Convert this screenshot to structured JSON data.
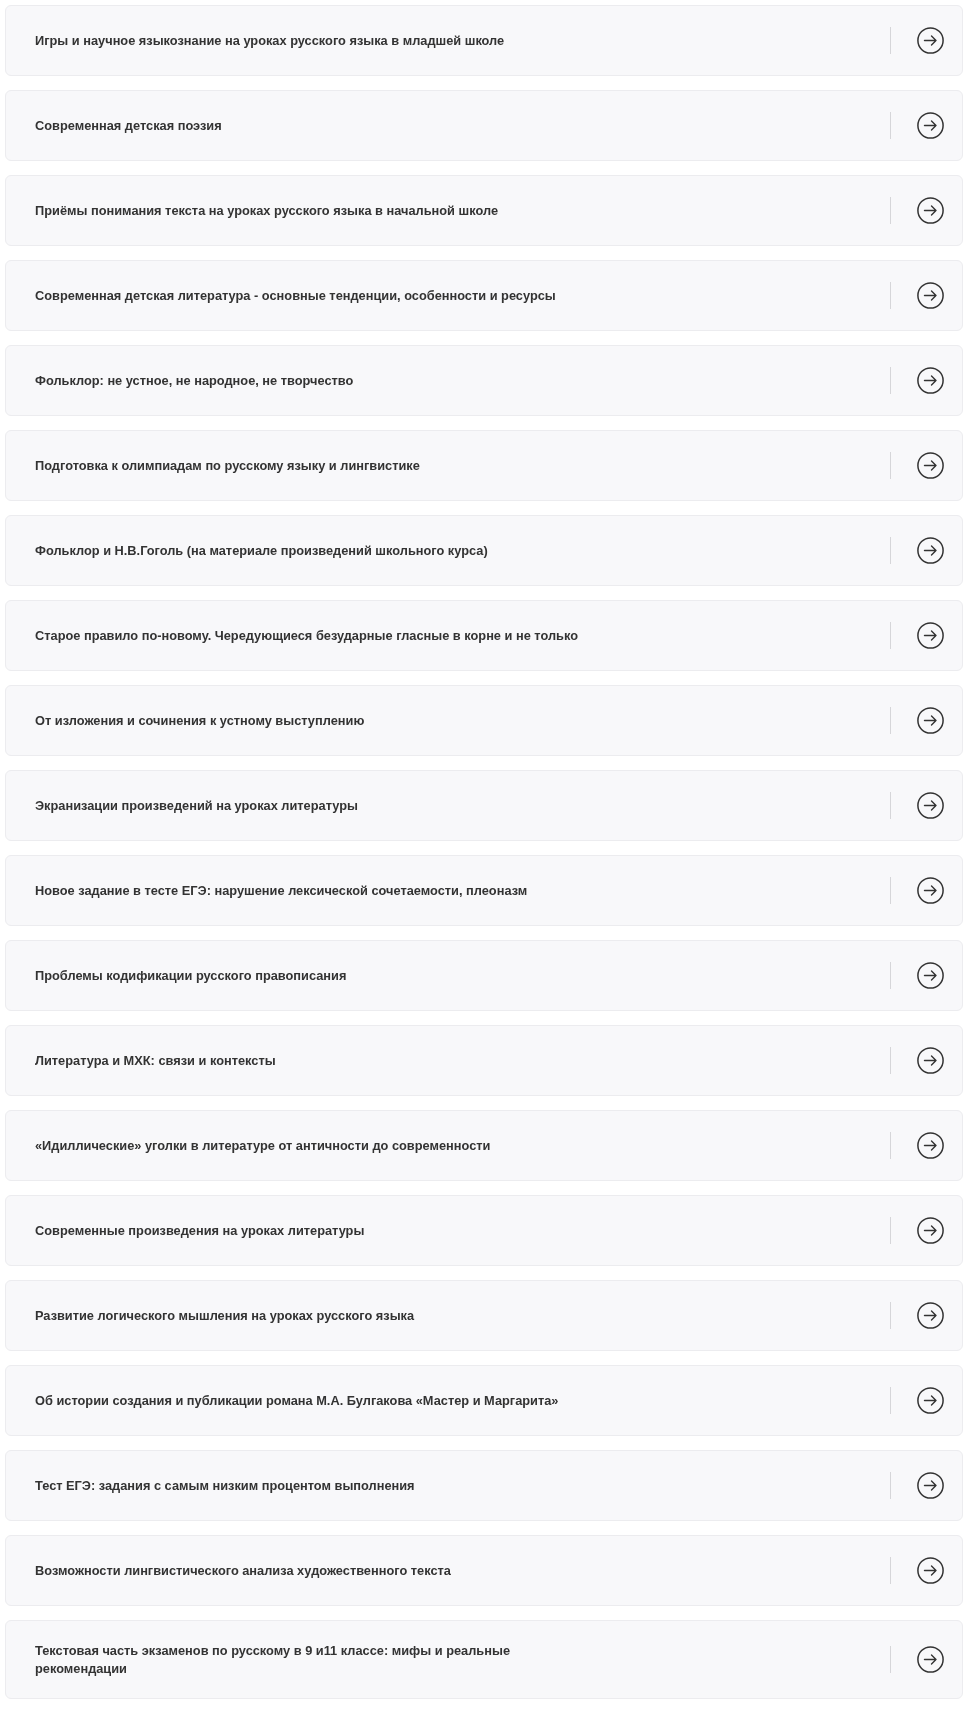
{
  "courses": [
    {
      "title": "Игры и научное языкознание на уроках русского языка в младшей школе"
    },
    {
      "title": "Современная детская поэзия"
    },
    {
      "title": "Приёмы понимания текста на уроках русского языка в начальной школе"
    },
    {
      "title": "Современная детская литература - основные тенденции, особенности и ресурсы"
    },
    {
      "title": "Фольклор: не устное, не народное, не творчество"
    },
    {
      "title": "Подготовка к олимпиадам по русскому языку и лингвистике"
    },
    {
      "title": "Фольклор и Н.В.Гоголь (на материале произведений школьного курса)"
    },
    {
      "title": "Старое правило по-новому. Чередующиеся безударные гласные в корне и не только"
    },
    {
      "title": "От изложения и сочинения к устному выступлению"
    },
    {
      "title": "Экранизации произведений на уроках литературы"
    },
    {
      "title": "Новое задание в тесте ЕГЭ: нарушение лексической сочетаемости, плеоназм"
    },
    {
      "title": "Проблемы кодификации русского правописания"
    },
    {
      "title": "Литература и МХК: связи и контексты"
    },
    {
      "title": "«Идиллические» уголки в литературе от античности до современности"
    },
    {
      "title": "Современные произведения на уроках литературы"
    },
    {
      "title": "Развитие логического мышления на уроках русского языка"
    },
    {
      "title": "Об истории создания и публикации романа М.А. Булгакова «Мастер и Маргарита»"
    },
    {
      "title": "Тест ЕГЭ: задания с самым низким процентом выполнения"
    },
    {
      "title": "Возможности лингвистического анализа художественного текста"
    },
    {
      "title": "Текстовая часть экзаменов по русскому в 9 и11 классе: мифы и реальные рекомендации"
    }
  ]
}
